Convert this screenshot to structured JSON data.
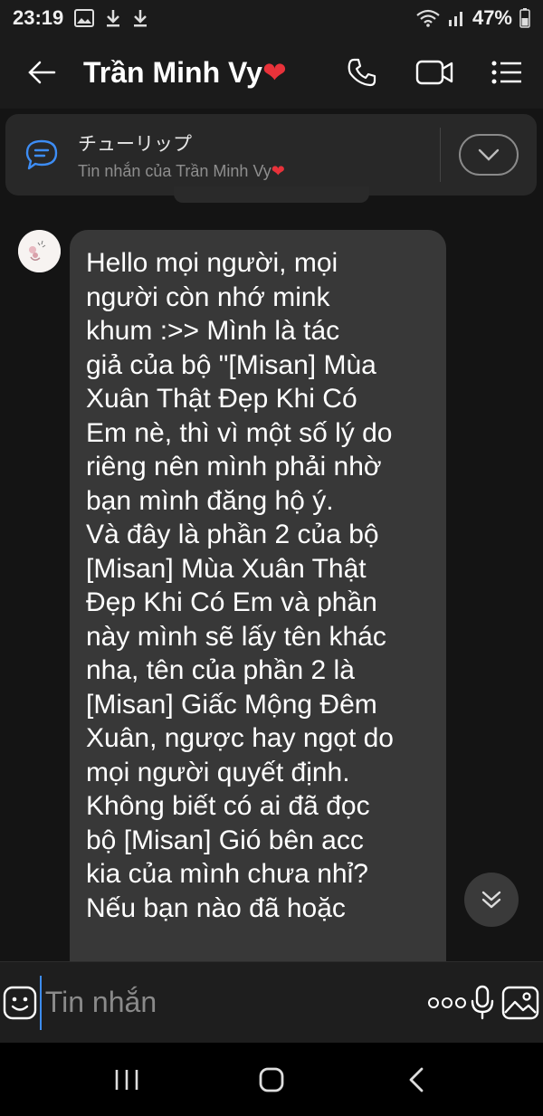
{
  "status_bar": {
    "time": "23:19",
    "battery": "47%",
    "icons": [
      "gallery-icon",
      "download-icon",
      "download-icon",
      "wifi-icon",
      "signal-icon",
      "battery-icon"
    ]
  },
  "header": {
    "contact_name": "Trần Minh Vy",
    "contact_emoji": "❤",
    "actions": [
      "phone-icon",
      "video-call-icon",
      "menu-list-icon"
    ]
  },
  "pinned": {
    "title": "チューリップ",
    "subtitle": "Tin nhắn của Trần Minh Vy",
    "subtitle_emoji": "❤"
  },
  "message": {
    "text": "Hello mọi người, mọi\nngười còn nhớ mink\nkhum :>> Mình là tác\ngiả của bộ \"[Misan] Mùa\nXuân Thật Đẹp Khi Có\nEm nè, thì vì một số lý do\nriêng nên mình phải nhờ\nbạn mình đăng hộ ý.\nVà đây là phần 2 của bộ\n[Misan] Mùa Xuân Thật\nĐẹp Khi Có Em và phần\nnày mình sẽ lấy tên khác\nnha, tên của phần 2 là\n[Misan] Giấc Mộng Đêm\nXuân, ngược hay ngọt do\nmọi người quyết định.\nKhông biết có ai đã đọc\nbộ [Misan] Gió bên acc\nkia của mình chưa nhỉ?\nNếu bạn nào đã hoặc"
  },
  "input": {
    "placeholder": "Tin nhắn"
  },
  "colors": {
    "background": "#141414",
    "bubble": "#383838",
    "accent": "#3d8df5",
    "heart": "#e8323a"
  }
}
